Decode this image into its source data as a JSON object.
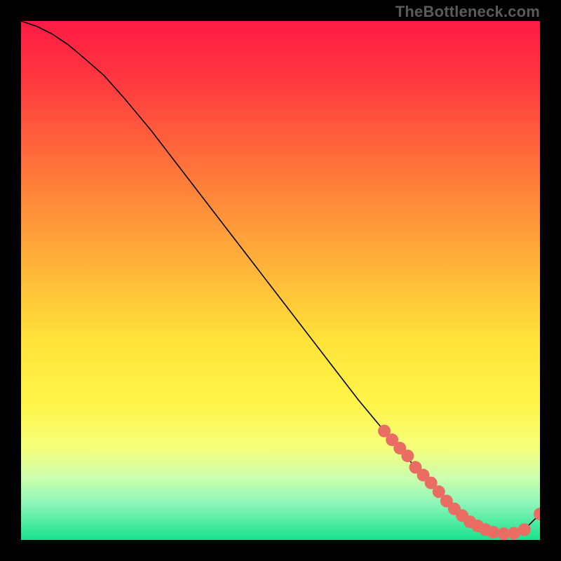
{
  "watermark": "TheBottleneck.com",
  "chart_data": {
    "type": "line",
    "title": "",
    "xlabel": "",
    "ylabel": "",
    "xlim": [
      0,
      100
    ],
    "ylim": [
      0,
      100
    ],
    "grid": false,
    "background_gradient": {
      "stops": [
        {
          "pct": 0,
          "color": "#ff1a45"
        },
        {
          "pct": 12,
          "color": "#ff3a3f"
        },
        {
          "pct": 30,
          "color": "#ff7a3a"
        },
        {
          "pct": 48,
          "color": "#ffb63a"
        },
        {
          "pct": 62,
          "color": "#ffe43a"
        },
        {
          "pct": 74,
          "color": "#fff54a"
        },
        {
          "pct": 82,
          "color": "#f6ff7a"
        },
        {
          "pct": 88,
          "color": "#ccffad"
        },
        {
          "pct": 93,
          "color": "#8cf5b8"
        },
        {
          "pct": 100,
          "color": "#18e28e"
        }
      ]
    },
    "series": [
      {
        "name": "curve",
        "color": "#000000",
        "width": 1.6,
        "x": [
          0,
          3,
          6,
          9,
          12,
          16,
          20,
          25,
          30,
          35,
          40,
          45,
          50,
          55,
          60,
          65,
          70,
          73,
          76,
          79,
          81,
          83,
          85,
          88,
          91,
          94,
          97,
          100
        ],
        "y": [
          100,
          99,
          97.5,
          95.5,
          93,
          89.5,
          85,
          79,
          72.5,
          66,
          59.5,
          53,
          46.5,
          40,
          33.5,
          27,
          21,
          17.5,
          14,
          11,
          8.5,
          6.5,
          5,
          3,
          1.7,
          1.2,
          2,
          5
        ]
      }
    ],
    "markers": {
      "name": "dots",
      "color": "#e96d62",
      "radius": 9,
      "points": [
        {
          "x": 70.0,
          "y": 21.0
        },
        {
          "x": 71.5,
          "y": 19.3
        },
        {
          "x": 73.0,
          "y": 17.7
        },
        {
          "x": 74.5,
          "y": 16.2
        },
        {
          "x": 76.0,
          "y": 14.0
        },
        {
          "x": 77.5,
          "y": 12.5
        },
        {
          "x": 79.0,
          "y": 11.0
        },
        {
          "x": 80.5,
          "y": 9.3
        },
        {
          "x": 82.0,
          "y": 7.5
        },
        {
          "x": 83.5,
          "y": 6.0
        },
        {
          "x": 85.0,
          "y": 4.7
        },
        {
          "x": 86.5,
          "y": 3.5
        },
        {
          "x": 88.0,
          "y": 2.7
        },
        {
          "x": 89.5,
          "y": 2.0
        },
        {
          "x": 91.0,
          "y": 1.5
        },
        {
          "x": 93.0,
          "y": 1.2
        },
        {
          "x": 95.0,
          "y": 1.3
        },
        {
          "x": 97.0,
          "y": 2.0
        },
        {
          "x": 100.0,
          "y": 5.0
        }
      ]
    }
  }
}
